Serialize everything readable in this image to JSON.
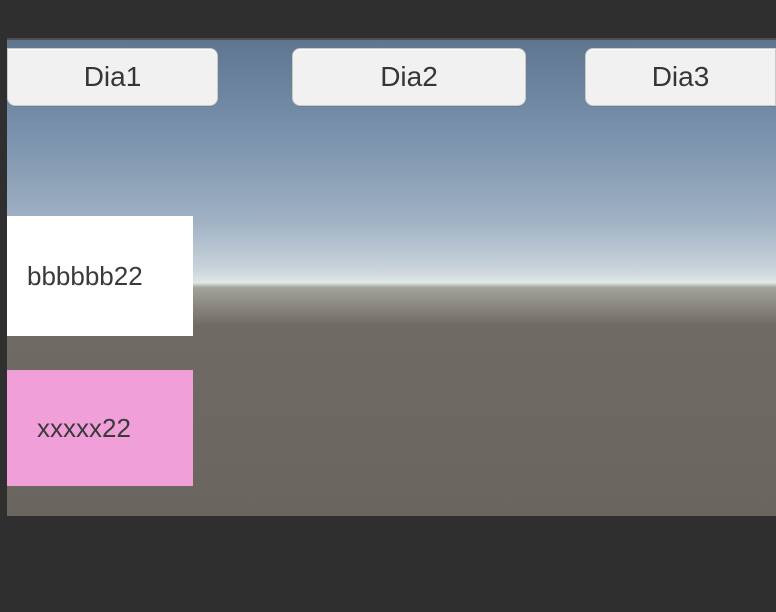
{
  "buttons": {
    "dia1": {
      "label": "Dia1"
    },
    "dia2": {
      "label": "Dia2"
    },
    "dia3": {
      "label": "Dia3"
    }
  },
  "panels": {
    "white": {
      "text": "bbbbbb22",
      "bg": "#ffffff"
    },
    "pink": {
      "text": "xxxxx22",
      "bg": "#f19fd9"
    }
  }
}
